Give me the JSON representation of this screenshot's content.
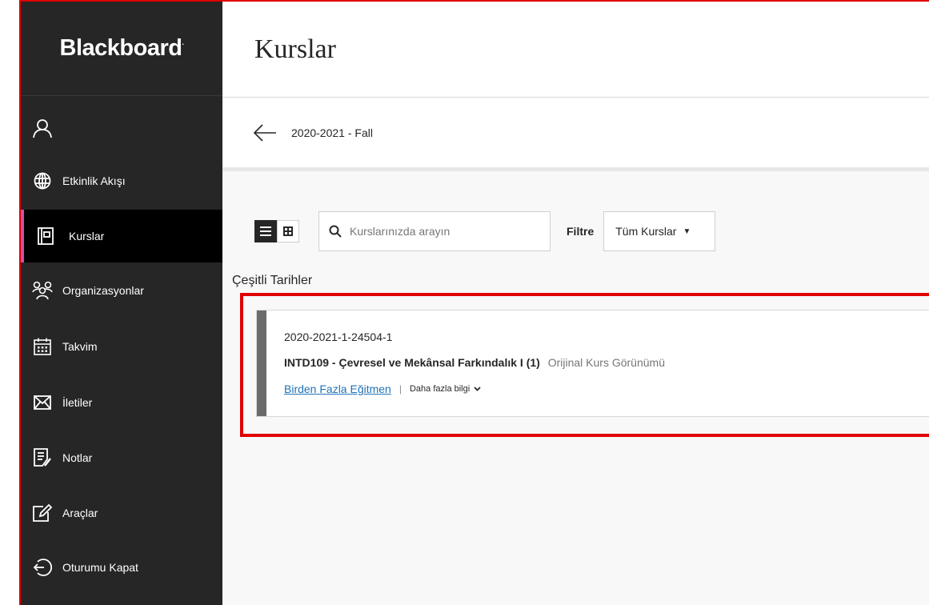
{
  "app": {
    "logo": "Blackboard",
    "logo_mark": "."
  },
  "sidebar": {
    "items": [
      {
        "label": "",
        "icon": "user-icon"
      },
      {
        "label": "Etkinlik Akışı",
        "icon": "globe-icon"
      },
      {
        "label": "Kurslar",
        "icon": "courses-icon",
        "active": true
      },
      {
        "label": "Organizasyonlar",
        "icon": "organizations-icon"
      },
      {
        "label": "Takvim",
        "icon": "calendar-icon"
      },
      {
        "label": "İletiler",
        "icon": "envelope-icon"
      },
      {
        "label": "Notlar",
        "icon": "grades-icon"
      },
      {
        "label": "Araçlar",
        "icon": "tools-icon"
      },
      {
        "label": "Oturumu Kapat",
        "icon": "logout-icon"
      }
    ]
  },
  "header": {
    "title": "Kurslar"
  },
  "breadcrumb": {
    "term": "2020-2021 - Fall"
  },
  "toolbar": {
    "search_placeholder": "Kurslarınızda arayın",
    "filter_label": "Filtre",
    "filter_value": "Tüm Kurslar"
  },
  "group": {
    "title": "Çeşitli Tarihler"
  },
  "course": {
    "id": "2020-2021-1-24504-1",
    "name": "INTD109 - Çevresel ve Mekânsal Farkındalık I (1)",
    "view": "Orijinal Kurs Görünümü",
    "instructors": "Birden Fazla Eğitmen",
    "separator": "|",
    "more_info": "Daha fazla bilgi"
  },
  "colors": {
    "sidebar_bg": "#262626",
    "active_accent": "#d24ea5",
    "link": "#2173b7",
    "annotation_red": "#e00000"
  }
}
